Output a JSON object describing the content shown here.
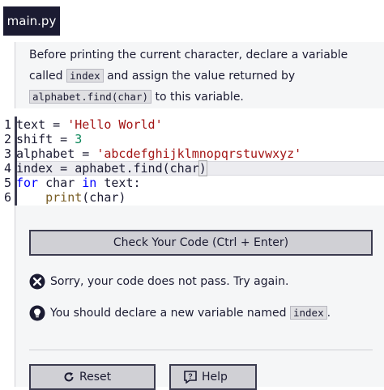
{
  "tab": {
    "label": "main.py"
  },
  "instructions": {
    "part1": "Before printing the current character, declare a variable called ",
    "code1": "index",
    "part2": " and assign the value returned by ",
    "code2": "alphabet.find(char)",
    "part3": " to this variable."
  },
  "editor": {
    "line_numbers": [
      "1",
      "2",
      "3",
      "4",
      "5",
      "6"
    ],
    "lines": [
      {
        "a": "text = ",
        "s": "'Hello World'"
      },
      {
        "a": "shift = ",
        "n": "3"
      },
      {
        "a": "alphabet = ",
        "s": "'abcdefghijklmnopqrstuvwxyz'"
      },
      {
        "a": "index = aphabet.find(",
        "b": "char",
        "c": ")"
      },
      {
        "k1": "for",
        "a": " char ",
        "k2": "in",
        "c": " text:"
      },
      {
        "a": "    ",
        "f": "print",
        "c": "(char)"
      }
    ]
  },
  "actions": {
    "check_label": "Check Your Code (Ctrl + Enter)",
    "reset_label": "Reset",
    "help_label": "Help"
  },
  "feedback": {
    "error_text": "Sorry, your code does not pass. Try again.",
    "hint_prefix": "You should declare a new variable named ",
    "hint_code": "index",
    "hint_suffix": "."
  },
  "colors": {
    "tab_bg": "#1b1b32",
    "panel_bg": "#f5f6f7",
    "button_bg": "#d0d0d5",
    "string": "#a31515",
    "keyword": "#0000ff"
  }
}
